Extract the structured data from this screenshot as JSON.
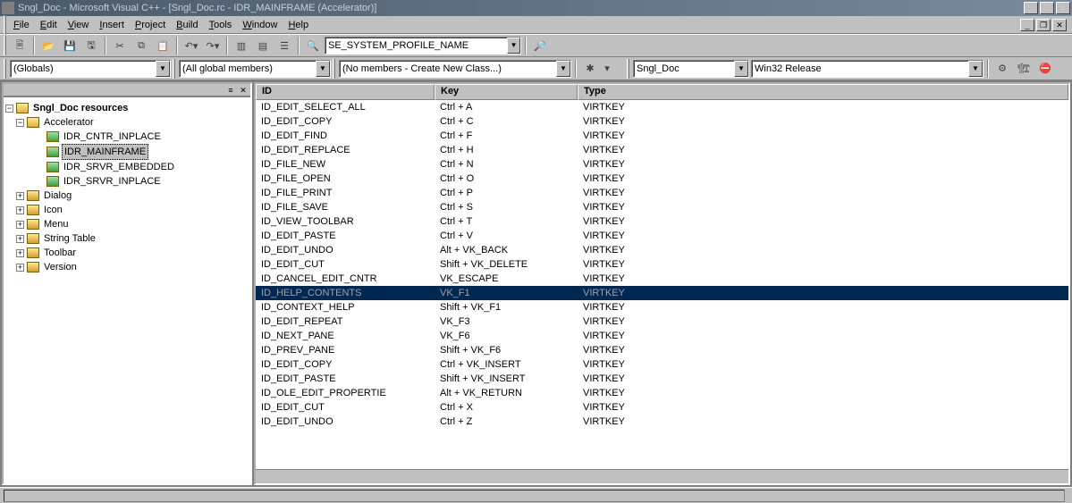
{
  "title": "Sngl_Doc - Microsoft Visual C++ - [Sngl_Doc.rc - IDR_MAINFRAME (Accelerator)]",
  "menus": [
    "File",
    "Edit",
    "View",
    "Insert",
    "Project",
    "Build",
    "Tools",
    "Window",
    "Help"
  ],
  "toolbar_combo": "SE_SYSTEM_PROFILE_NAME",
  "wizbar": {
    "scope": "(Globals)",
    "members": "(All global members)",
    "functions": "(No members - Create New Class...)",
    "project": "Sngl_Doc",
    "config": "Win32 Release"
  },
  "tree": {
    "root": "Sngl_Doc resources",
    "accelerator": {
      "label": "Accelerator",
      "items": [
        "IDR_CNTR_INPLACE",
        "IDR_MAINFRAME",
        "IDR_SRVR_EMBEDDED",
        "IDR_SRVR_INPLACE"
      ],
      "selected_index": 1
    },
    "folders": [
      "Dialog",
      "Icon",
      "Menu",
      "String Table",
      "Toolbar",
      "Version"
    ]
  },
  "columns": [
    "ID",
    "Key",
    "Type"
  ],
  "rows": [
    {
      "id": "ID_EDIT_SELECT_ALL",
      "key": "Ctrl + A",
      "type": "VIRTKEY"
    },
    {
      "id": "ID_EDIT_COPY",
      "key": "Ctrl + C",
      "type": "VIRTKEY"
    },
    {
      "id": "ID_EDIT_FIND",
      "key": "Ctrl + F",
      "type": "VIRTKEY"
    },
    {
      "id": "ID_EDIT_REPLACE",
      "key": "Ctrl + H",
      "type": "VIRTKEY"
    },
    {
      "id": "ID_FILE_NEW",
      "key": "Ctrl + N",
      "type": "VIRTKEY"
    },
    {
      "id": "ID_FILE_OPEN",
      "key": "Ctrl + O",
      "type": "VIRTKEY"
    },
    {
      "id": "ID_FILE_PRINT",
      "key": "Ctrl + P",
      "type": "VIRTKEY"
    },
    {
      "id": "ID_FILE_SAVE",
      "key": "Ctrl + S",
      "type": "VIRTKEY"
    },
    {
      "id": "ID_VIEW_TOOLBAR",
      "key": "Ctrl + T",
      "type": "VIRTKEY"
    },
    {
      "id": "ID_EDIT_PASTE",
      "key": "Ctrl + V",
      "type": "VIRTKEY"
    },
    {
      "id": "ID_EDIT_UNDO",
      "key": "Alt + VK_BACK",
      "type": "VIRTKEY"
    },
    {
      "id": "ID_EDIT_CUT",
      "key": "Shift + VK_DELETE",
      "type": "VIRTKEY"
    },
    {
      "id": "ID_CANCEL_EDIT_CNTR",
      "key": "VK_ESCAPE",
      "type": "VIRTKEY"
    },
    {
      "id": "ID_HELP_CONTENTS",
      "key": "VK_F1",
      "type": "VIRTKEY",
      "selected": true
    },
    {
      "id": "ID_CONTEXT_HELP",
      "key": "Shift + VK_F1",
      "type": "VIRTKEY"
    },
    {
      "id": "ID_EDIT_REPEAT",
      "key": "VK_F3",
      "type": "VIRTKEY"
    },
    {
      "id": "ID_NEXT_PANE",
      "key": "VK_F6",
      "type": "VIRTKEY"
    },
    {
      "id": "ID_PREV_PANE",
      "key": "Shift + VK_F6",
      "type": "VIRTKEY"
    },
    {
      "id": "ID_EDIT_COPY",
      "key": "Ctrl + VK_INSERT",
      "type": "VIRTKEY"
    },
    {
      "id": "ID_EDIT_PASTE",
      "key": "Shift + VK_INSERT",
      "type": "VIRTKEY"
    },
    {
      "id": "ID_OLE_EDIT_PROPERTIE",
      "key": "Alt + VK_RETURN",
      "type": "VIRTKEY"
    },
    {
      "id": "ID_EDIT_CUT",
      "key": "Ctrl + X",
      "type": "VIRTKEY"
    },
    {
      "id": "ID_EDIT_UNDO",
      "key": "Ctrl + Z",
      "type": "VIRTKEY"
    }
  ]
}
